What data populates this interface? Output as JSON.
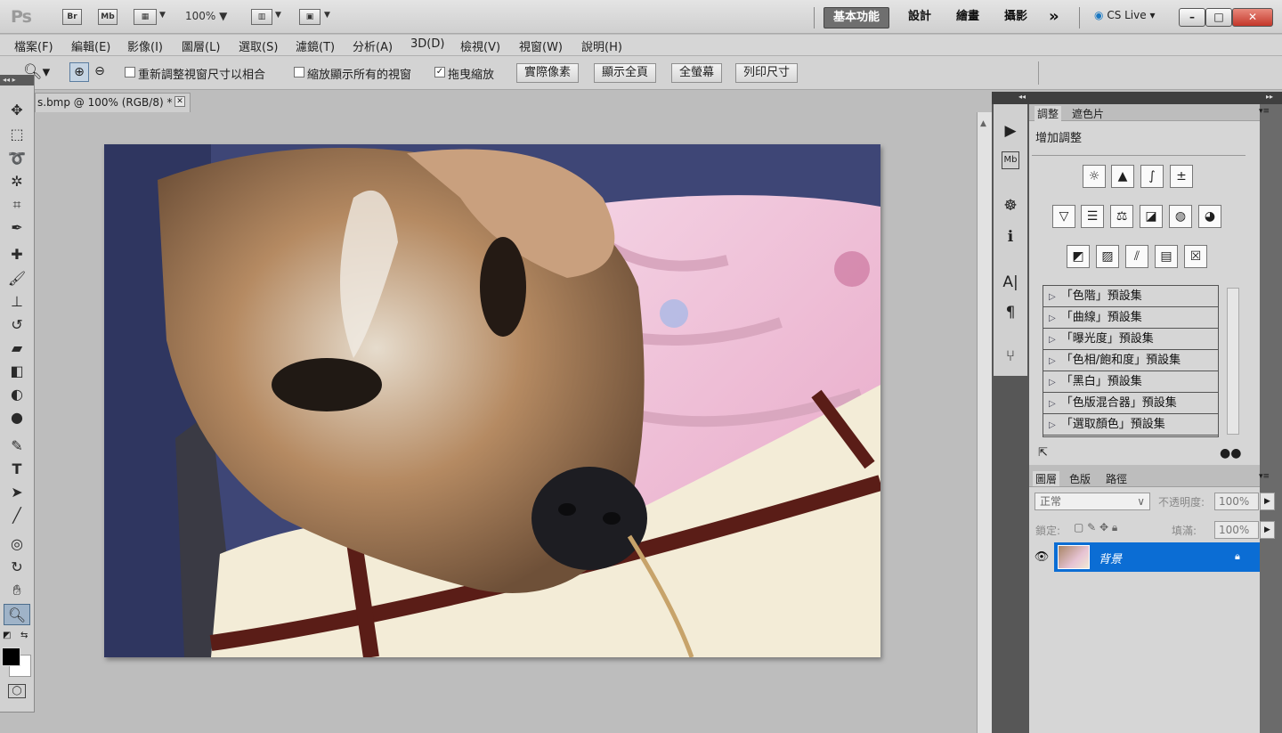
{
  "app": {
    "logo": "Ps",
    "icons": [
      "Br",
      "Mb"
    ],
    "zoom": "100%",
    "workspaces": [
      "基本功能",
      "設計",
      "繪畫",
      "攝影"
    ],
    "more": "»",
    "cslive": "CS Live",
    "window_buttons": [
      "–",
      "□",
      "✕"
    ]
  },
  "menubar": [
    "檔案(F)",
    "編輯(E)",
    "影像(I)",
    "圖層(L)",
    "選取(S)",
    "濾鏡(T)",
    "分析(A)",
    "3D(D)",
    "檢視(V)",
    "視窗(W)",
    "說明(H)"
  ],
  "options": {
    "checkboxes": [
      {
        "label": "重新調整視窗尺寸以相合",
        "checked": false
      },
      {
        "label": "縮放顯示所有的視窗",
        "checked": false
      },
      {
        "label": "拖曳縮放",
        "checked": true
      }
    ],
    "buttons": [
      "實際像素",
      "顯示全頁",
      "全螢幕",
      "列印尺寸"
    ]
  },
  "document": {
    "tab_title": "s.bmp @ 100% (RGB/8) *",
    "close": "✕"
  },
  "adjustments": {
    "tabs": [
      "調整",
      "遮色片"
    ],
    "heading": "增加調整",
    "presets": [
      "「色階」預設集",
      "「曲線」預設集",
      "「曝光度」預設集",
      "「色相/飽和度」預設集",
      "「黑白」預設集",
      "「色版混合器」預設集",
      "「選取顏色」預設集"
    ]
  },
  "layers": {
    "tabs": [
      "圖層",
      "色版",
      "路徑"
    ],
    "blend_mode": "正常",
    "opacity_label": "不透明度:",
    "opacity_value": "100%",
    "lock_label": "鎖定:",
    "fill_label": "填滿:",
    "fill_value": "100%",
    "layer_name": "背景"
  },
  "colors": {
    "accent": "#0b6dd4",
    "panel": "#d6d6d6",
    "dark": "#575757"
  }
}
